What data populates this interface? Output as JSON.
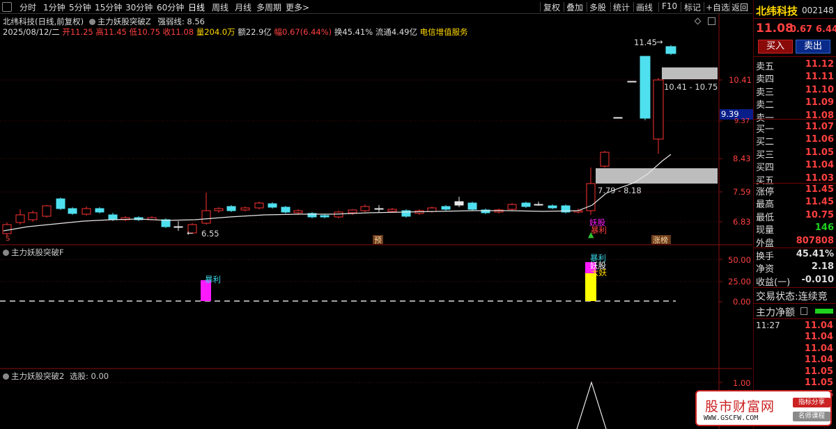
{
  "toolbar": {
    "left_tabs": [
      "分时",
      "1分钟",
      "5分钟",
      "15分钟",
      "30分钟",
      "60分钟",
      "日线",
      "周线",
      "月线",
      "多周期",
      "更多>"
    ],
    "active_tab": "日线",
    "right_buttons": [
      "复权",
      "叠加",
      "多股",
      "统计",
      "画线",
      "F10",
      "标记",
      "+自选",
      "返回"
    ]
  },
  "header": {
    "stock_title": "北纬科技(日线,前复权)",
    "indicator_name": "主力妖股突破Z",
    "strength_label": "强弱线: 8.56",
    "date": "2025/08/12/二",
    "open": "开11.25",
    "high": "高11.45",
    "low": "低10.75",
    "close": "收11.08",
    "volume": "量204.0万",
    "amount": "额22.9亿",
    "change": "幅0.67(6.44%)",
    "turnover": "换45.41%",
    "float": "流通4.49亿",
    "industry": "电信增值服务"
  },
  "price_axis": {
    "labels": [
      "10.41",
      "9.37",
      "8.43",
      "7.59",
      "6.83"
    ],
    "current_price_tag": "9.39"
  },
  "chart_annotations": {
    "high_label": "11.45",
    "low_label": "6.55",
    "zone_upper": "10.41 - 10.75",
    "zone_lower": "7.79 - 8.18",
    "signal_yaogu": "妖股",
    "signal_baoli": "暴利",
    "marker_s": "S",
    "marker_yu": "预",
    "marker_zhangting": "涨榜"
  },
  "panel2": {
    "title": "主力妖股突破F",
    "axis": [
      "50.00",
      "25.00",
      "0.00"
    ],
    "label_baoli": "暴利",
    "label_top": "暴利",
    "label_mid": "妖股",
    "label_bot": "大妖"
  },
  "panel3": {
    "title": "主力妖股突破2",
    "value_label": "选股: 0.00",
    "axis": [
      "1.00"
    ]
  },
  "right_panel": {
    "name": "北纬科技",
    "code": "002148",
    "price": "11.08",
    "change": "0.67",
    "change_pct": "6.44",
    "buy_button": "买入",
    "sell_button": "卖出",
    "asks": [
      {
        "label": "卖五",
        "price": "11.12"
      },
      {
        "label": "卖四",
        "price": "11.11"
      },
      {
        "label": "卖三",
        "price": "11.10"
      },
      {
        "label": "卖二",
        "price": "11.09"
      },
      {
        "label": "卖一",
        "price": "11.08"
      }
    ],
    "bids": [
      {
        "label": "买一",
        "price": "11.07"
      },
      {
        "label": "买二",
        "price": "11.06"
      },
      {
        "label": "买三",
        "price": "11.05"
      },
      {
        "label": "买四",
        "price": "11.04"
      },
      {
        "label": "买五",
        "price": "11.03"
      }
    ],
    "stats": [
      {
        "label": "涨停",
        "value": "11.45"
      },
      {
        "label": "最高",
        "value": "11.45"
      },
      {
        "label": "最低",
        "value": "10.75"
      },
      {
        "label": "现量",
        "value": "146"
      },
      {
        "label": "外盘",
        "value": "807808"
      }
    ],
    "stats2": [
      {
        "label": "换手",
        "value": "45.41%"
      },
      {
        "label": "净资",
        "value": "2.18"
      },
      {
        "label": "收益(一)",
        "value": "-0.010"
      }
    ],
    "trade_status": "交易状态:连续竞",
    "main_flow": "主力净额",
    "ticks_time": "11:27",
    "ticks": [
      "11.04",
      "11.04",
      "11.04",
      "11.05",
      "11.05",
      "11.05"
    ],
    "ticks_first": "11.04"
  },
  "watermark": {
    "title": "股市财富网",
    "url": "WWW.GSCFW.COM",
    "tag1": "指标分享",
    "tag2": "名师课程"
  }
}
